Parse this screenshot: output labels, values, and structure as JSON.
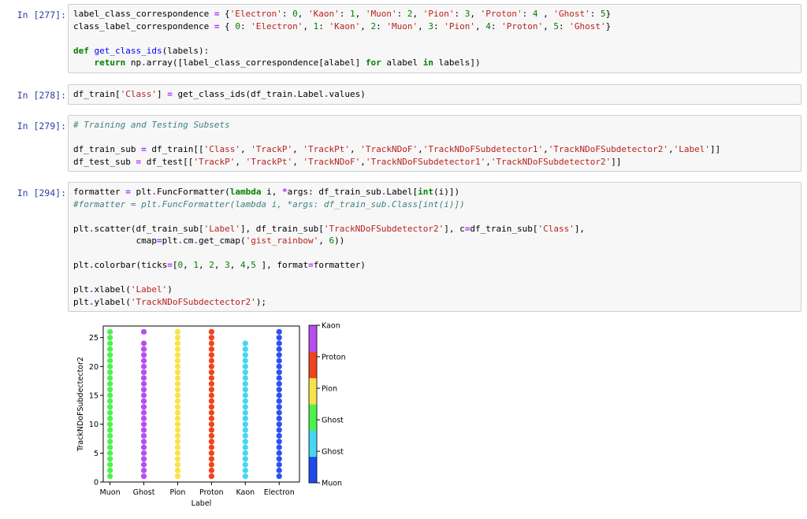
{
  "cells": [
    {
      "prompt": "In [277]:",
      "lines": [
        [
          [
            "label_class_correspondence ",
            "t"
          ],
          [
            "=",
            "op"
          ],
          [
            " {",
            "t"
          ],
          [
            "'Electron'",
            "st"
          ],
          [
            ": ",
            "t"
          ],
          [
            "0",
            "nm"
          ],
          [
            ", ",
            "t"
          ],
          [
            "'Kaon'",
            "st"
          ],
          [
            ": ",
            "t"
          ],
          [
            "1",
            "nm"
          ],
          [
            ", ",
            "t"
          ],
          [
            "'Muon'",
            "st"
          ],
          [
            ": ",
            "t"
          ],
          [
            "2",
            "nm"
          ],
          [
            ", ",
            "t"
          ],
          [
            "'Pion'",
            "st"
          ],
          [
            ": ",
            "t"
          ],
          [
            "3",
            "nm"
          ],
          [
            ", ",
            "t"
          ],
          [
            "'Proton'",
            "st"
          ],
          [
            ": ",
            "t"
          ],
          [
            "4",
            "nm"
          ],
          [
            " , ",
            "t"
          ],
          [
            "'Ghost'",
            "st"
          ],
          [
            ": ",
            "t"
          ],
          [
            "5",
            "nm"
          ],
          [
            "}",
            "t"
          ]
        ],
        [
          [
            "class_label_correspondence ",
            "t"
          ],
          [
            "=",
            "op"
          ],
          [
            " { ",
            "t"
          ],
          [
            "0",
            "nm"
          ],
          [
            ": ",
            "t"
          ],
          [
            "'Electron'",
            "st"
          ],
          [
            ", ",
            "t"
          ],
          [
            "1",
            "nm"
          ],
          [
            ": ",
            "t"
          ],
          [
            "'Kaon'",
            "st"
          ],
          [
            ", ",
            "t"
          ],
          [
            "2",
            "nm"
          ],
          [
            ": ",
            "t"
          ],
          [
            "'Muon'",
            "st"
          ],
          [
            ", ",
            "t"
          ],
          [
            "3",
            "nm"
          ],
          [
            ": ",
            "t"
          ],
          [
            "'Pion'",
            "st"
          ],
          [
            ", ",
            "t"
          ],
          [
            "4",
            "nm"
          ],
          [
            ": ",
            "t"
          ],
          [
            "'Proton'",
            "st"
          ],
          [
            ", ",
            "t"
          ],
          [
            "5",
            "nm"
          ],
          [
            ": ",
            "t"
          ],
          [
            "'Ghost'",
            "st"
          ],
          [
            "}",
            "t"
          ]
        ],
        [],
        [
          [
            "def",
            "kw"
          ],
          [
            " ",
            "t"
          ],
          [
            "get_class_ids",
            "fn"
          ],
          [
            "(labels):",
            "t"
          ]
        ],
        [
          [
            "    ",
            "t"
          ],
          [
            "return",
            "kw"
          ],
          [
            " np",
            "t"
          ],
          [
            ".",
            "op"
          ],
          [
            "array([label_class_correspondence[alabel] ",
            "t"
          ],
          [
            "for",
            "kw"
          ],
          [
            " alabel ",
            "t"
          ],
          [
            "in",
            "kw"
          ],
          [
            " labels])",
            "t"
          ]
        ]
      ]
    },
    {
      "prompt": "In [278]:",
      "lines": [
        [
          [
            "df_train[",
            "t"
          ],
          [
            "'Class'",
            "st"
          ],
          [
            "] ",
            "t"
          ],
          [
            "=",
            "op"
          ],
          [
            " get_class_ids(df_train",
            "t"
          ],
          [
            ".",
            "op"
          ],
          [
            "Label",
            "t"
          ],
          [
            ".",
            "op"
          ],
          [
            "values)",
            "t"
          ]
        ]
      ]
    },
    {
      "prompt": "In [279]:",
      "lines": [
        [
          [
            "# Training and Testing Subsets",
            "cm"
          ]
        ],
        [],
        [
          [
            "df_train_sub ",
            "t"
          ],
          [
            "=",
            "op"
          ],
          [
            " df_train[[",
            "t"
          ],
          [
            "'Class'",
            "st"
          ],
          [
            ", ",
            "t"
          ],
          [
            "'TrackP'",
            "st"
          ],
          [
            ", ",
            "t"
          ],
          [
            "'TrackPt'",
            "st"
          ],
          [
            ", ",
            "t"
          ],
          [
            "'TrackNDoF'",
            "st"
          ],
          [
            ",",
            "t"
          ],
          [
            "'TrackNDoFSubdetector1'",
            "st"
          ],
          [
            ",",
            "t"
          ],
          [
            "'TrackNDoFSubdetector2'",
            "st"
          ],
          [
            ",",
            "t"
          ],
          [
            "'Label'",
            "st"
          ],
          [
            "]]",
            "t"
          ]
        ],
        [
          [
            "df_test_sub ",
            "t"
          ],
          [
            "=",
            "op"
          ],
          [
            " df_test[[",
            "t"
          ],
          [
            "'TrackP'",
            "st"
          ],
          [
            ", ",
            "t"
          ],
          [
            "'TrackPt'",
            "st"
          ],
          [
            ", ",
            "t"
          ],
          [
            "'TrackNDoF'",
            "st"
          ],
          [
            ",",
            "t"
          ],
          [
            "'TrackNDoFSubdetector1'",
            "st"
          ],
          [
            ",",
            "t"
          ],
          [
            "'TrackNDoFSubdetector2'",
            "st"
          ],
          [
            "]]",
            "t"
          ]
        ]
      ]
    },
    {
      "prompt": "In [294]:",
      "lines": [
        [
          [
            "formatter ",
            "t"
          ],
          [
            "=",
            "op"
          ],
          [
            " plt",
            "t"
          ],
          [
            ".",
            "op"
          ],
          [
            "FuncFormatter(",
            "t"
          ],
          [
            "lambda",
            "kw"
          ],
          [
            " i, ",
            "t"
          ],
          [
            "*",
            "op"
          ],
          [
            "args: df_train_sub",
            "t"
          ],
          [
            ".",
            "op"
          ],
          [
            "Label[",
            "t"
          ],
          [
            "int",
            "kw"
          ],
          [
            "(i)])",
            "t"
          ]
        ],
        [
          [
            "#formatter = plt.FuncFormatter(lambda i, *args: df_train_sub.Class[int(i)])",
            "cm"
          ]
        ],
        [],
        [
          [
            "plt",
            "t"
          ],
          [
            ".",
            "op"
          ],
          [
            "scatter(df_train_sub[",
            "t"
          ],
          [
            "'Label'",
            "st"
          ],
          [
            "], df_train_sub[",
            "t"
          ],
          [
            "'TrackNDoFSubdetector2'",
            "st"
          ],
          [
            "], c",
            "t"
          ],
          [
            "=",
            "op"
          ],
          [
            "df_train_sub[",
            "t"
          ],
          [
            "'Class'",
            "st"
          ],
          [
            "],",
            "t"
          ]
        ],
        [
          [
            "            cmap",
            "t"
          ],
          [
            "=",
            "op"
          ],
          [
            "plt",
            "t"
          ],
          [
            ".",
            "op"
          ],
          [
            "cm",
            "t"
          ],
          [
            ".",
            "op"
          ],
          [
            "get_cmap(",
            "t"
          ],
          [
            "'gist_rainbow'",
            "st"
          ],
          [
            ", ",
            "t"
          ],
          [
            "6",
            "nm"
          ],
          [
            "))",
            "t"
          ]
        ],
        [],
        [
          [
            "plt",
            "t"
          ],
          [
            ".",
            "op"
          ],
          [
            "colorbar(ticks",
            "t"
          ],
          [
            "=",
            "op"
          ],
          [
            "[",
            "t"
          ],
          [
            "0",
            "nm"
          ],
          [
            ", ",
            "t"
          ],
          [
            "1",
            "nm"
          ],
          [
            ", ",
            "t"
          ],
          [
            "2",
            "nm"
          ],
          [
            ", ",
            "t"
          ],
          [
            "3",
            "nm"
          ],
          [
            ", ",
            "t"
          ],
          [
            "4",
            "nm"
          ],
          [
            ",",
            "t"
          ],
          [
            "5",
            "nm"
          ],
          [
            " ], format",
            "t"
          ],
          [
            "=",
            "op"
          ],
          [
            "formatter)",
            "t"
          ]
        ],
        [],
        [
          [
            "plt",
            "t"
          ],
          [
            ".",
            "op"
          ],
          [
            "xlabel(",
            "t"
          ],
          [
            "'Label'",
            "st"
          ],
          [
            ")",
            "t"
          ]
        ],
        [
          [
            "plt",
            "t"
          ],
          [
            ".",
            "op"
          ],
          [
            "ylabel(",
            "t"
          ],
          [
            "'TrackNDoFSubdectector2'",
            "st"
          ],
          [
            ");",
            "t"
          ]
        ]
      ]
    }
  ],
  "chart_data": {
    "type": "scatter",
    "xlabel": "Label",
    "ylabel": "TrackNDoFSubdectector2",
    "categories": [
      "Muon",
      "Ghost",
      "Pion",
      "Proton",
      "Kaon",
      "Electron"
    ],
    "ylim": [
      0,
      27
    ],
    "yticks": [
      0,
      5,
      10,
      15,
      20,
      25
    ],
    "grid": false,
    "series": [
      {
        "category": "Muon",
        "color": "#4cf24c",
        "y": [
          1,
          2,
          3,
          4,
          5,
          6,
          7,
          8,
          9,
          10,
          11,
          12,
          13,
          14,
          15,
          16,
          17,
          18,
          19,
          20,
          21,
          22,
          23,
          24,
          25,
          26
        ]
      },
      {
        "category": "Ghost",
        "color": "#b84ef0",
        "y": [
          1,
          2,
          3,
          4,
          5,
          6,
          7,
          8,
          9,
          10,
          11,
          12,
          13,
          14,
          15,
          16,
          17,
          18,
          19,
          20,
          21,
          22,
          23,
          24,
          26
        ]
      },
      {
        "category": "Pion",
        "color": "#f8e24a",
        "y": [
          1,
          2,
          3,
          4,
          5,
          6,
          7,
          8,
          9,
          10,
          11,
          12,
          13,
          14,
          15,
          16,
          17,
          18,
          19,
          20,
          21,
          22,
          23,
          24,
          25,
          26
        ]
      },
      {
        "category": "Proton",
        "color": "#f0441e",
        "y": [
          1,
          2,
          3,
          4,
          5,
          6,
          7,
          8,
          9,
          10,
          11,
          12,
          13,
          14,
          15,
          16,
          17,
          18,
          19,
          20,
          21,
          22,
          23,
          24,
          25,
          26
        ]
      },
      {
        "category": "Kaon",
        "color": "#46d6f2",
        "y": [
          1,
          2,
          3,
          4,
          5,
          6,
          7,
          8,
          9,
          10,
          11,
          12,
          13,
          14,
          15,
          16,
          17,
          18,
          19,
          20,
          21,
          22,
          23,
          24
        ]
      },
      {
        "category": "Electron",
        "color": "#2f50f2",
        "y": [
          1,
          2,
          3,
          4,
          5,
          6,
          7,
          8,
          9,
          10,
          11,
          12,
          13,
          14,
          15,
          16,
          17,
          18,
          19,
          20,
          21,
          22,
          23,
          24,
          25,
          26
        ]
      }
    ],
    "colorbar": {
      "ticklabels": [
        "Muon",
        "Ghost",
        "Ghost",
        "Pion",
        "Proton",
        "Kaon"
      ],
      "colors": [
        "#1e4bf0",
        "#46d6f2",
        "#4cf24c",
        "#f8e24a",
        "#f0441e",
        "#b84ef0"
      ]
    }
  }
}
